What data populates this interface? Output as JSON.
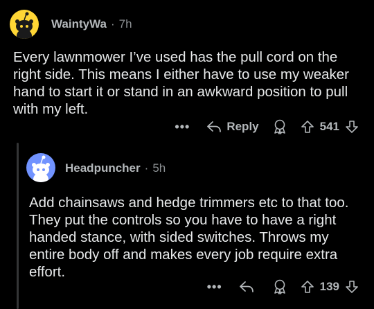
{
  "comments": [
    {
      "username": "WaintyWa",
      "separator": "·",
      "time": "7h",
      "body": "Every lawnmower I’ve used has the pull cord on the right side. This means I either have to use my weaker hand to start it or stand in an awkward position to pull with my left.",
      "more": "•••",
      "reply_label": "Reply",
      "score": "541",
      "avatar_color": "#ffd635"
    },
    {
      "username": "Headpuncher",
      "separator": "·",
      "time": "5h",
      "body": "Add chainsaws and hedge trimmers etc to that too. They put the controls so you have to have a right handed stance, with sided switches. Throws my entire body off and makes every job require extra effort.",
      "more": "•••",
      "score": "139",
      "avatar_color": "#7193ff"
    }
  ],
  "icons": [
    "snoo-avatar-icon",
    "reply-arrow-icon",
    "award-icon",
    "upvote-arrow-icon",
    "downvote-arrow-icon"
  ]
}
